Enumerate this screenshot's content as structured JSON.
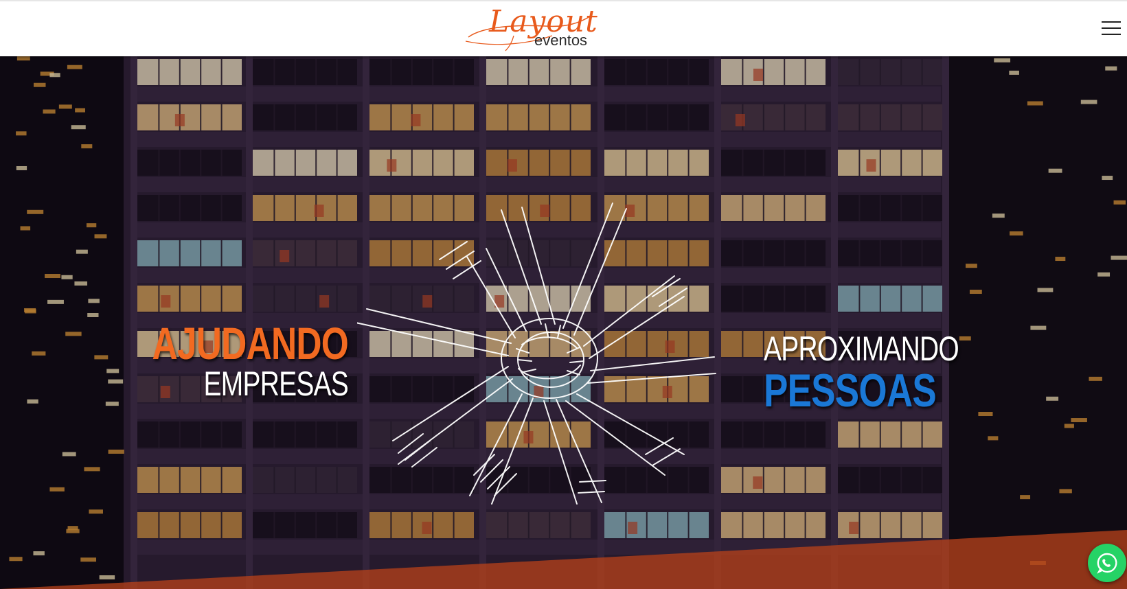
{
  "header": {
    "logo": {
      "script_text": "Layout",
      "sub_text": "eventos"
    },
    "menu_icon": "hamburger-menu-icon"
  },
  "hero": {
    "left_headline": {
      "line1": "AJUDANDO",
      "line2": "EMPRESAS"
    },
    "right_headline": {
      "line1": "APROXIMANDO",
      "line2": "PESSOAS"
    },
    "illustration": "hands-together-sketch",
    "background": "night-office-building"
  },
  "floating": {
    "whatsapp_icon": "whatsapp-icon"
  },
  "colors": {
    "brand_orange": "#f26a21",
    "brand_blue": "#1a78d6",
    "whatsapp_green": "#25d366",
    "header_bg": "#ffffff"
  }
}
